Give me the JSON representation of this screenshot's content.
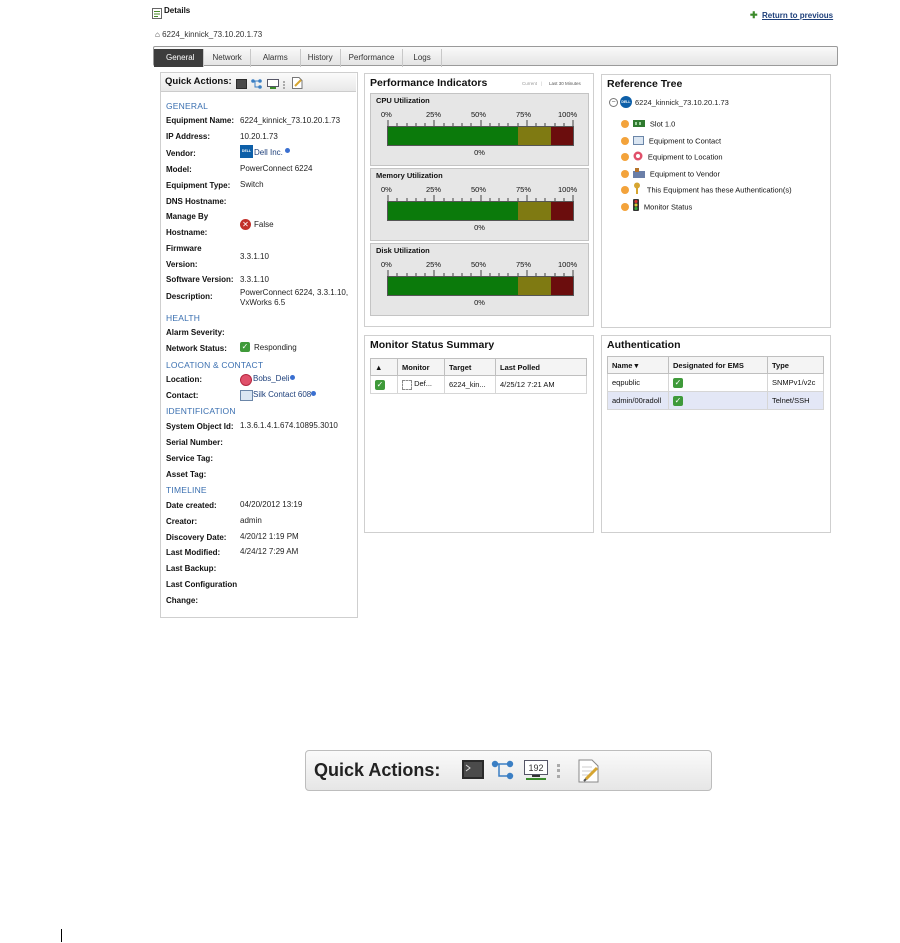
{
  "header": {
    "title": "Details",
    "return_link": "Return to previous",
    "breadcrumb": "6224_kinnick_73.10.20.1.73"
  },
  "tabs": [
    "General",
    "Network",
    "Alarms",
    "History",
    "Performance",
    "Logs"
  ],
  "active_tab": "General",
  "quick_actions": {
    "label": "Quick Actions:",
    "icons": [
      "terminal-icon",
      "topology-icon",
      "ip-address-icon",
      "separator-icon",
      "edit-note-icon"
    ]
  },
  "general": {
    "section": "GENERAL",
    "equipment_name_label": "Equipment Name:",
    "equipment_name": "6224_kinnick_73.10.20.1.73",
    "ip_label": "IP Address:",
    "ip": "10.20.1.73",
    "vendor_label": "Vendor:",
    "vendor": "Dell Inc.",
    "vendor_logo": "DELL",
    "model_label": "Model:",
    "model": "PowerConnect 6224",
    "equipment_type_label": "Equipment Type:",
    "equipment_type": "Switch",
    "dns_label": "DNS Hostname:",
    "manage_label_1": "Manage By",
    "manage_label_2": "Hostname:",
    "manage_value": "False",
    "firmware_label_1": "Firmware",
    "firmware_label_2": "Version:",
    "firmware": "3.3.1.10",
    "software_label": "Software Version:",
    "software": "3.3.1.10",
    "description_label": "Description:",
    "description_1": "PowerConnect 6224, 3.3.1.10,",
    "description_2": "VxWorks 6.5"
  },
  "health": {
    "section": "HEALTH",
    "alarm_label": "Alarm Severity:",
    "network_label": "Network Status:",
    "network_status": "Responding"
  },
  "location_contact": {
    "section": "LOCATION & CONTACT",
    "location_label": "Location:",
    "location": "Bobs_Deli",
    "contact_label": "Contact:",
    "contact": "Silk Contact 608"
  },
  "identification": {
    "section": "IDENTIFICATION",
    "sysobj_label": "System Object Id:",
    "sysobj": "1.3.6.1.4.1.674.10895.3010",
    "serial_label": "Serial Number:",
    "service_label": "Service Tag:",
    "asset_label": "Asset Tag:"
  },
  "timeline": {
    "section": "TIMELINE",
    "created_label": "Date created:",
    "created": "04/20/2012 13:19",
    "creator_label": "Creator:",
    "creator": "admin",
    "discovery_label": "Discovery Date:",
    "discovery": "4/20/12 1:19 PM",
    "modified_label": "Last Modified:",
    "modified": "4/24/12 7:29 AM",
    "backup_label": "Last Backup:",
    "config_label_1": "Last Configuration",
    "config_label_2": "Change:"
  },
  "performance": {
    "title": "Performance Indicators",
    "link_current": "Current",
    "link_last": "Last 30 Minutes",
    "ticks": [
      "0%",
      "25%",
      "50%",
      "75%",
      "100%"
    ],
    "gauges": [
      {
        "title": "CPU Utilization",
        "value": "0%"
      },
      {
        "title": "Memory Utilization",
        "value": "0%"
      },
      {
        "title": "Disk Utilization",
        "value": "0%"
      }
    ],
    "zone_colors": {
      "normal": "#0b7a0b",
      "warning": "#7f7a12",
      "critical": "#6b0d0d"
    }
  },
  "reference_tree": {
    "title": "Reference Tree",
    "root": "6224_kinnick_73.10.20.1.73",
    "items": [
      "Slot 1.0",
      "Equipment to Contact",
      "Equipment to Location",
      "Equipment to Vendor",
      "This Equipment has these Authentication(s)",
      "Monitor Status"
    ]
  },
  "monitor_summary": {
    "title": "Monitor Status Summary",
    "columns": [
      "▲",
      "Monitor",
      "Target",
      "Last Polled"
    ],
    "rows": [
      {
        "monitor": "Def...",
        "target": "6224_kin...",
        "last_polled": "4/25/12 7:21 AM"
      }
    ]
  },
  "authentication": {
    "title": "Authentication",
    "columns": [
      "Name ▾",
      "Designated for EMS",
      "Type"
    ],
    "rows": [
      {
        "name": "eqpublic",
        "type": "SNMPv1/v2c"
      },
      {
        "name": "admin/00radoll",
        "type": "Telnet/SSH"
      }
    ]
  }
}
